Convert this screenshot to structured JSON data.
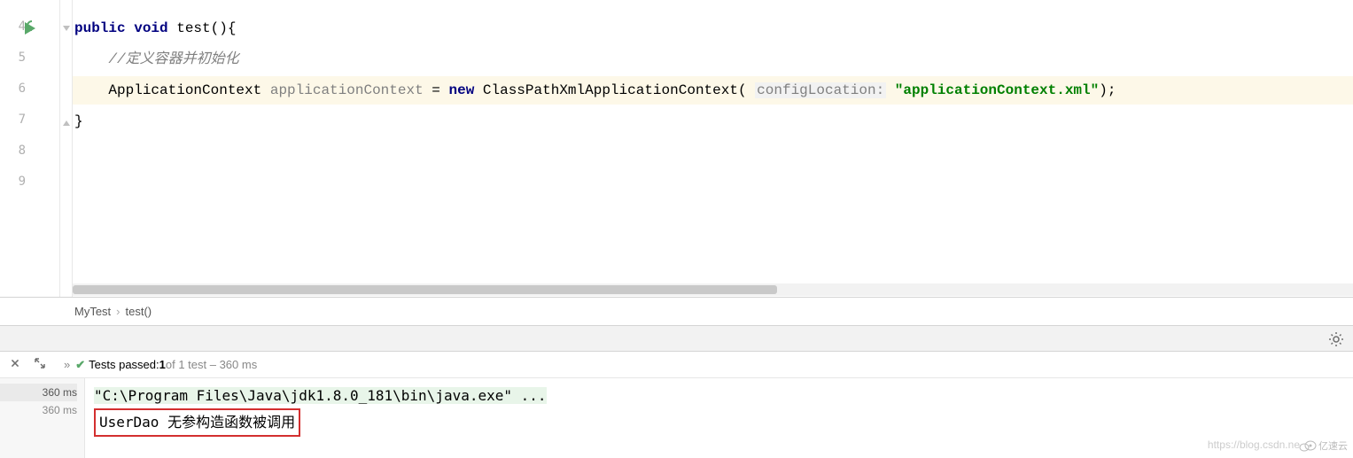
{
  "lines": {
    "l4": "4",
    "l5": "5",
    "l6": "6",
    "l7": "7",
    "l8": "8",
    "l9": "9"
  },
  "code": {
    "kw_public": "public",
    "kw_void": "void",
    "method_sig": " test(){",
    "comment": "//定义容器并初始化",
    "type1": "ApplicationContext ",
    "var1": "applicationContext",
    "eq": " = ",
    "kw_new": "new",
    "type2": " ClassPathXmlApplicationContext( ",
    "param_hint": "configLocation:",
    "str_val": " \"applicationContext.xml\"",
    "close_paren": ");",
    "close_brace": "}"
  },
  "breadcrumb": {
    "item1": "MyTest",
    "sep": "›",
    "item2": "test()"
  },
  "test_status": {
    "chev": "»",
    "check": "✔",
    "label": "Tests passed: ",
    "count": "1",
    "rest": " of 1 test – 360 ms"
  },
  "timings": {
    "t1": "360 ms",
    "t2": "360 ms"
  },
  "console": {
    "line1": "\"C:\\Program Files\\Java\\jdk1.8.0_181\\bin\\java.exe\" ...",
    "line2": "UserDao 无参构造函数被调用"
  },
  "watermark": "https://blog.csdn.ne",
  "logo": "亿速云"
}
